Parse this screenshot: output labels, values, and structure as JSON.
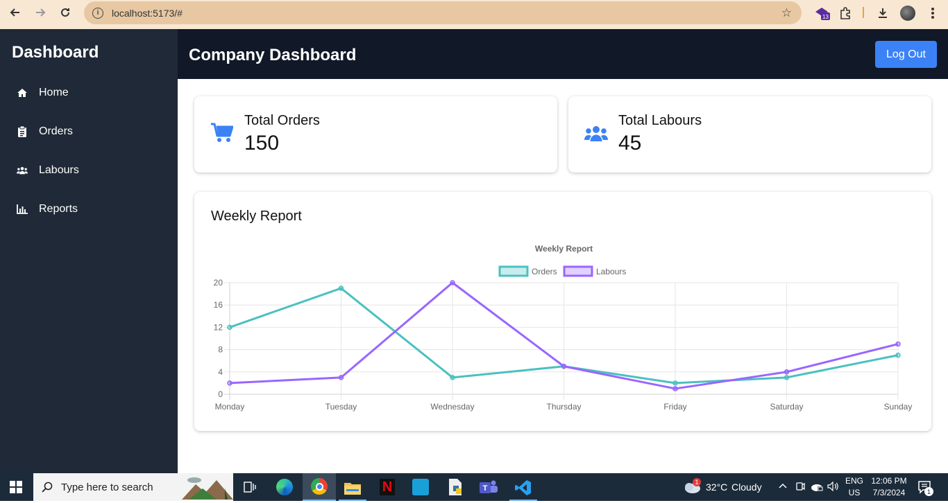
{
  "browser": {
    "url": "localhost:5173/#",
    "ext_badge": "13"
  },
  "sidebar": {
    "title": "Dashboard",
    "items": [
      {
        "label": "Home",
        "icon": "home-icon"
      },
      {
        "label": "Orders",
        "icon": "clipboard-icon"
      },
      {
        "label": "Labours",
        "icon": "users-icon"
      },
      {
        "label": "Reports",
        "icon": "chart-icon"
      }
    ]
  },
  "header": {
    "title": "Company Dashboard",
    "logout_label": "Log Out"
  },
  "stats": [
    {
      "label": "Total Orders",
      "value": "150",
      "icon": "shopping-cart-icon"
    },
    {
      "label": "Total Labours",
      "value": "45",
      "icon": "users-icon"
    }
  ],
  "report": {
    "heading": "Weekly Report"
  },
  "chart_data": {
    "type": "line",
    "title": "Weekly Report",
    "categories": [
      "Monday",
      "Tuesday",
      "Wednesday",
      "Thursday",
      "Friday",
      "Saturday",
      "Sunday"
    ],
    "series": [
      {
        "name": "Orders",
        "values": [
          12,
          19,
          3,
          5,
          2,
          3,
          7
        ],
        "color": "#4bc0c0"
      },
      {
        "name": "Labours",
        "values": [
          2,
          3,
          20,
          5,
          1,
          4,
          9
        ],
        "color": "#9966ff"
      }
    ],
    "ylim": [
      0,
      20
    ],
    "yticks": [
      "0",
      "4",
      "8",
      "12",
      "16",
      "20"
    ],
    "grid": true,
    "legend": "top"
  },
  "taskbar": {
    "search_placeholder": "Type here to search",
    "weather_temp": "32°C",
    "weather_desc": "Cloudy",
    "weather_badge": "1",
    "lang": "ENG",
    "region": "US",
    "time": "12:06 PM",
    "date": "7/3/2024",
    "notif_count": "1"
  },
  "colors": {
    "accent": "#3b82f6",
    "sidebar_bg": "#1f2937",
    "header_bg": "#111827"
  }
}
